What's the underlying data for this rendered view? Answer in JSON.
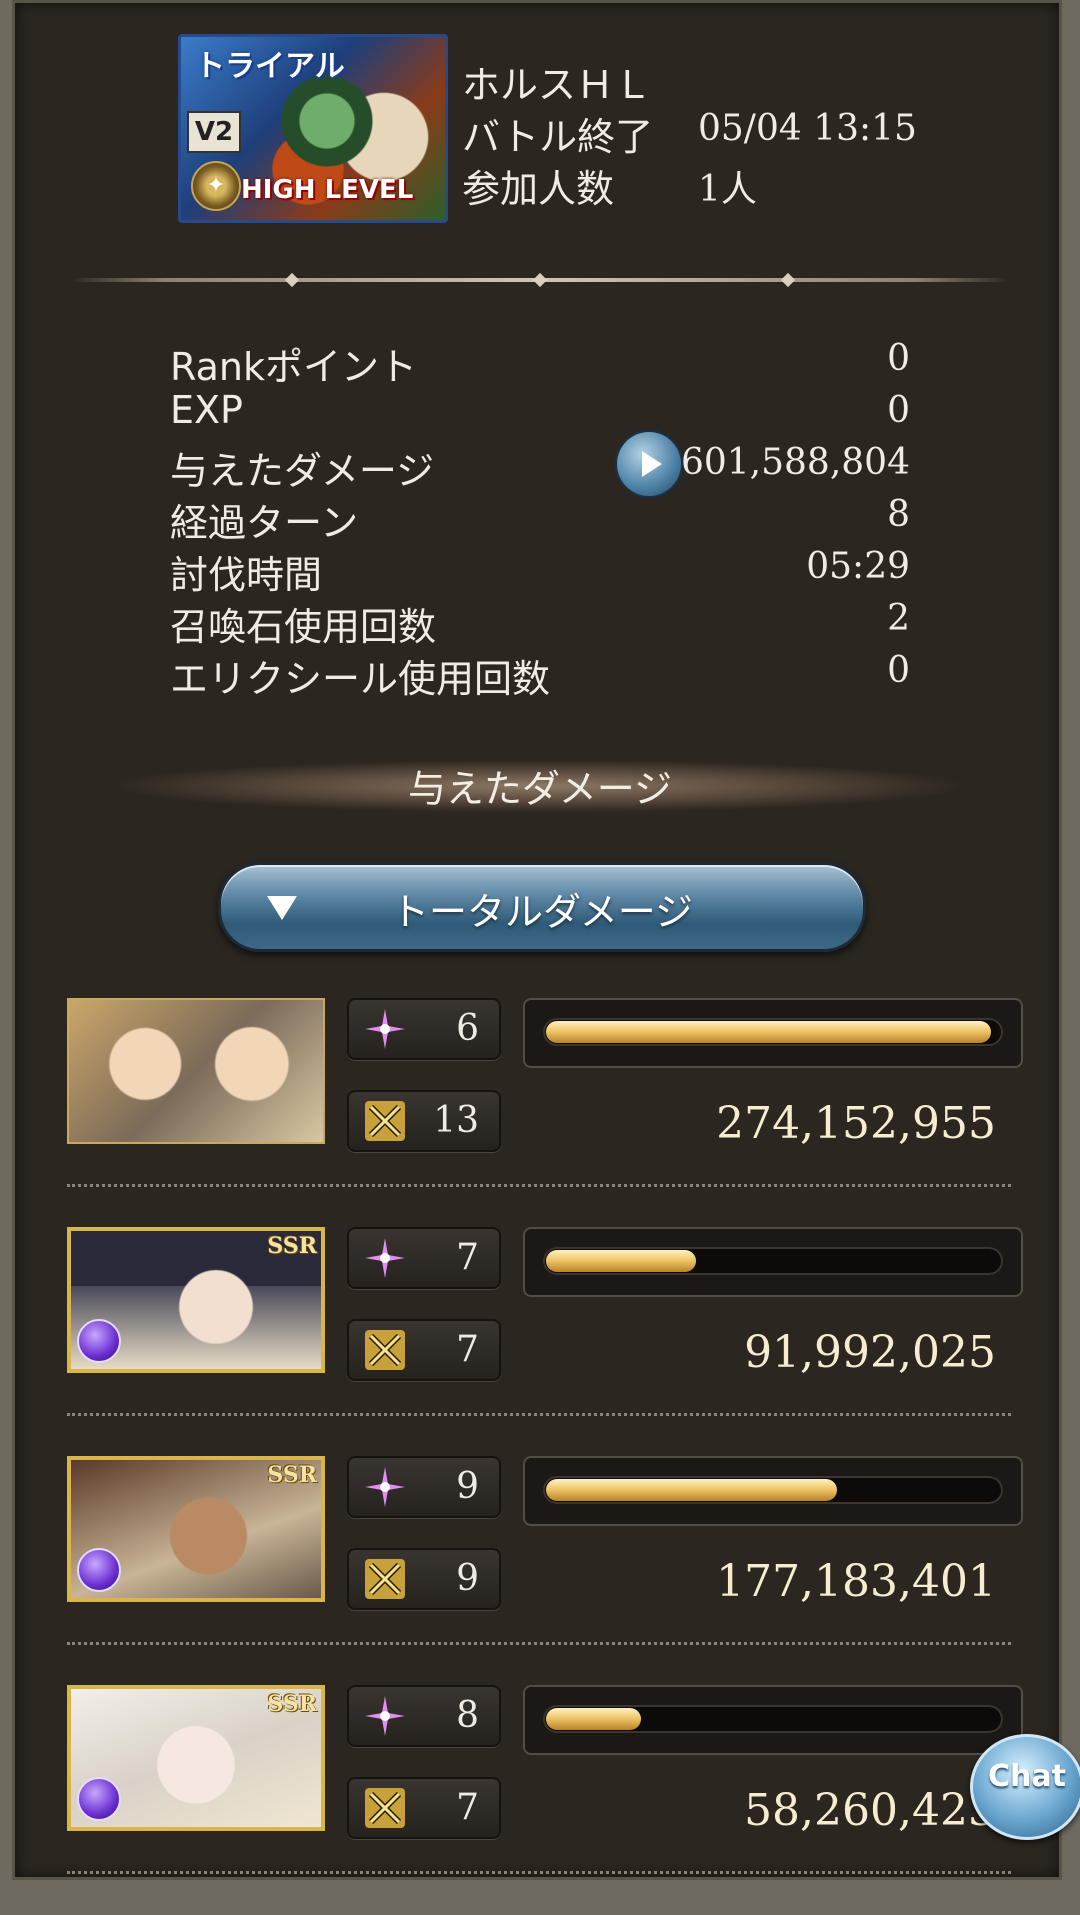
{
  "quest": {
    "banner_tag": "トライアル",
    "banner_version": "V2",
    "banner_level": "HIGH LEVEL",
    "name": "ホルスＨＬ",
    "battle_end_label": "バトル終了",
    "battle_end_value": "05/04 13:15",
    "participants_label": "参加人数",
    "participants_value": "1人"
  },
  "stats": [
    {
      "label": "Rankポイント",
      "value": "0"
    },
    {
      "label": "EXP",
      "value": "0"
    },
    {
      "label": "与えたダメージ",
      "value": "601,588,804"
    },
    {
      "label": "経過ターン",
      "value": "8"
    },
    {
      "label": "討伐時間",
      "value": "05:29"
    },
    {
      "label": "召喚石使用回数",
      "value": "2"
    },
    {
      "label": "エリクシール使用回数",
      "value": "0"
    }
  ],
  "section_title": "与えたダメージ",
  "dropdown_label": "トータルダメージ",
  "characters": [
    {
      "skill_count": "6",
      "attack_count": "13",
      "damage": "274,152,955",
      "bar_fraction": 0.98,
      "rarity": "",
      "element_color": ""
    },
    {
      "skill_count": "7",
      "attack_count": "7",
      "damage": "91,992,025",
      "bar_fraction": 0.33,
      "rarity": "SSR",
      "element_color": "#6b2fd1"
    },
    {
      "skill_count": "9",
      "attack_count": "9",
      "damage": "177,183,401",
      "bar_fraction": 0.64,
      "rarity": "SSR",
      "element_color": "#6b2fd1"
    },
    {
      "skill_count": "8",
      "attack_count": "7",
      "damage": "58,260,423",
      "bar_fraction": 0.21,
      "rarity": "SSR",
      "element_color": "#6b2fd1"
    }
  ],
  "chat_label": "Chat",
  "icons": {
    "skill": "sparkle-icon",
    "attack": "crossed-swords-icon",
    "play": "play-icon",
    "dropdown": "triangle-down-icon"
  },
  "colors": {
    "background": "#2b2620",
    "text": "#f0ece4",
    "bar_gold": "#f0c76a",
    "button_blue": "#5f89a6"
  }
}
